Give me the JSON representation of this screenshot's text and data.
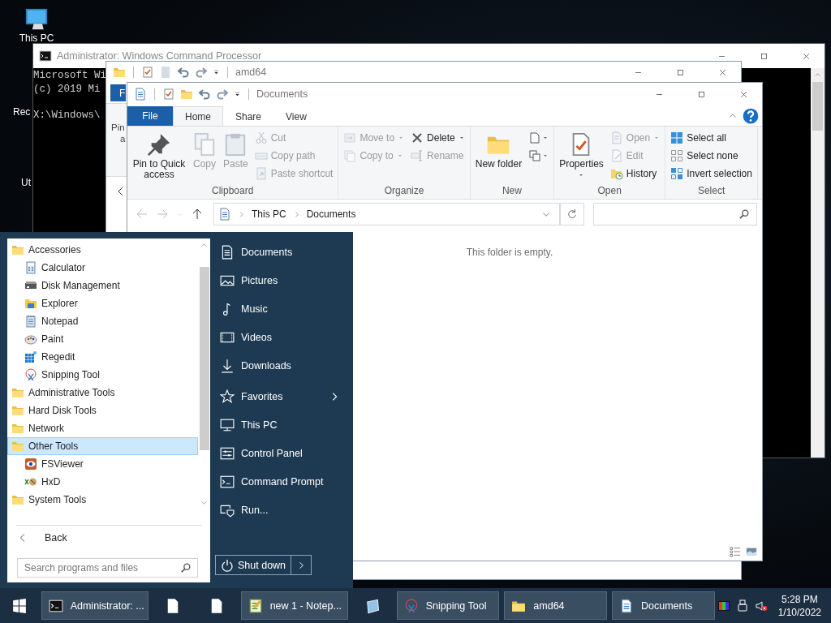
{
  "desktop_icons": [
    {
      "label": "This PC",
      "kind": "pc"
    },
    {
      "label": "Rec",
      "kind": "cut"
    },
    {
      "label": "Ut",
      "kind": "cut"
    }
  ],
  "cmd_window": {
    "title": "Administrator: Windows Command Processor",
    "lines": [
      "Microsoft Wi",
      "(c) 2019 Mi",
      "X:\\Windows\\"
    ]
  },
  "amd64_window": {
    "title": "amd64",
    "file_tab": "F",
    "ribbon_label_lines": [
      "Pin",
      "a"
    ]
  },
  "explorer": {
    "title": "Documents",
    "tabs": [
      {
        "label": "File",
        "kind": "file",
        "selected": false
      },
      {
        "label": "Home",
        "kind": "tab",
        "selected": true
      },
      {
        "label": "Share",
        "kind": "tab",
        "selected": false
      },
      {
        "label": "View",
        "kind": "tab",
        "selected": false
      }
    ],
    "ribbon_groups": [
      {
        "label": "Clipboard",
        "columns": [
          [
            {
              "label": "Pin to Quick access",
              "kind": "large",
              "disabled": false
            }
          ],
          [
            {
              "label": "Copy",
              "kind": "large",
              "disabled": true
            }
          ],
          [
            {
              "label": "Paste",
              "kind": "large",
              "disabled": true
            }
          ],
          [
            {
              "label": "Cut",
              "kind": "small",
              "disabled": true
            },
            {
              "label": "Copy path",
              "kind": "small",
              "disabled": true
            },
            {
              "label": "Paste shortcut",
              "kind": "small",
              "disabled": true
            }
          ]
        ]
      },
      {
        "label": "Organize",
        "columns": [
          [
            {
              "label": "Move to",
              "kind": "small",
              "disabled": true,
              "dropdown": true
            },
            {
              "label": "Copy to",
              "kind": "small",
              "disabled": true,
              "dropdown": true
            }
          ],
          [
            {
              "label": "Delete",
              "kind": "small",
              "disabled": false,
              "dropdown": true
            },
            {
              "label": "Rename",
              "kind": "small",
              "disabled": true
            }
          ]
        ]
      },
      {
        "label": "New",
        "columns": [
          [
            {
              "label": "New folder",
              "kind": "large",
              "disabled": false
            }
          ],
          [
            {
              "kind": "icon",
              "disabled": false,
              "dropdown": true
            },
            {
              "kind": "icon",
              "disabled": false,
              "dropdown": true
            }
          ]
        ]
      },
      {
        "label": "Open",
        "columns": [
          [
            {
              "label": "Properties",
              "kind": "large",
              "disabled": false,
              "dropdown": true
            }
          ],
          [
            {
              "label": "Open",
              "kind": "small",
              "disabled": true,
              "dropdown": true
            },
            {
              "label": "Edit",
              "kind": "small",
              "disabled": true
            },
            {
              "label": "History",
              "kind": "small",
              "disabled": false
            }
          ]
        ]
      },
      {
        "label": "Select",
        "columns": [
          [
            {
              "label": "Select all",
              "kind": "small",
              "disabled": false
            },
            {
              "label": "Select none",
              "kind": "small",
              "disabled": false
            },
            {
              "label": "Invert selection",
              "kind": "small",
              "disabled": false
            }
          ]
        ]
      }
    ],
    "breadcrumb": [
      "This PC",
      "Documents"
    ],
    "empty_message": "This folder is empty."
  },
  "start_menu": {
    "programs": [
      {
        "label": "Accessories",
        "kind": "folder",
        "selected": false,
        "children": [
          {
            "label": "Calculator",
            "kind": "app",
            "selected": false
          },
          {
            "label": "Disk Management",
            "kind": "app",
            "selected": false
          },
          {
            "label": "Explorer",
            "kind": "app",
            "selected": false
          },
          {
            "label": "Notepad",
            "kind": "app",
            "selected": false
          },
          {
            "label": "Paint",
            "kind": "app",
            "selected": false
          },
          {
            "label": "Regedit",
            "kind": "app",
            "selected": false
          },
          {
            "label": "Snipping Tool",
            "kind": "app",
            "selected": false
          }
        ]
      },
      {
        "label": "Administrative Tools",
        "kind": "folder",
        "selected": false
      },
      {
        "label": "Hard Disk Tools",
        "kind": "folder",
        "selected": false
      },
      {
        "label": "Network",
        "kind": "folder",
        "selected": false
      },
      {
        "label": "Other Tools",
        "kind": "folder",
        "selected": true,
        "children": [
          {
            "label": "FSViewer",
            "kind": "app",
            "selected": false
          },
          {
            "label": "HxD",
            "kind": "app",
            "selected": false
          }
        ]
      },
      {
        "label": "System Tools",
        "kind": "folder",
        "selected": false
      }
    ],
    "back": "Back",
    "search_placeholder": "Search programs and files",
    "places": [
      {
        "label": "Documents",
        "kind": "link"
      },
      {
        "label": "Pictures",
        "kind": "link"
      },
      {
        "label": "Music",
        "kind": "link"
      },
      {
        "label": "Videos",
        "kind": "link"
      },
      {
        "label": "Downloads",
        "kind": "link"
      },
      {
        "label": "Favorites",
        "kind": "submenu"
      },
      {
        "label": "This PC",
        "kind": "link"
      },
      {
        "label": "Control Panel",
        "kind": "link"
      },
      {
        "label": "Command Prompt",
        "kind": "link"
      },
      {
        "label": "Run...",
        "kind": "link"
      }
    ],
    "shutdown": "Shut down"
  },
  "taskbar": {
    "buttons": [
      {
        "label": "Administrator: ...",
        "kind": "labeled"
      },
      {
        "kind": "icon"
      },
      {
        "kind": "icon"
      },
      {
        "label": "new 1 - Notep...",
        "kind": "labeled"
      },
      {
        "kind": "icon"
      },
      {
        "label": "Snipping Tool",
        "kind": "labeled"
      },
      {
        "label": "amd64",
        "kind": "labeled"
      },
      {
        "label": "Documents",
        "kind": "labeled"
      }
    ],
    "time": "5:28 PM",
    "date": "1/10/2022"
  }
}
